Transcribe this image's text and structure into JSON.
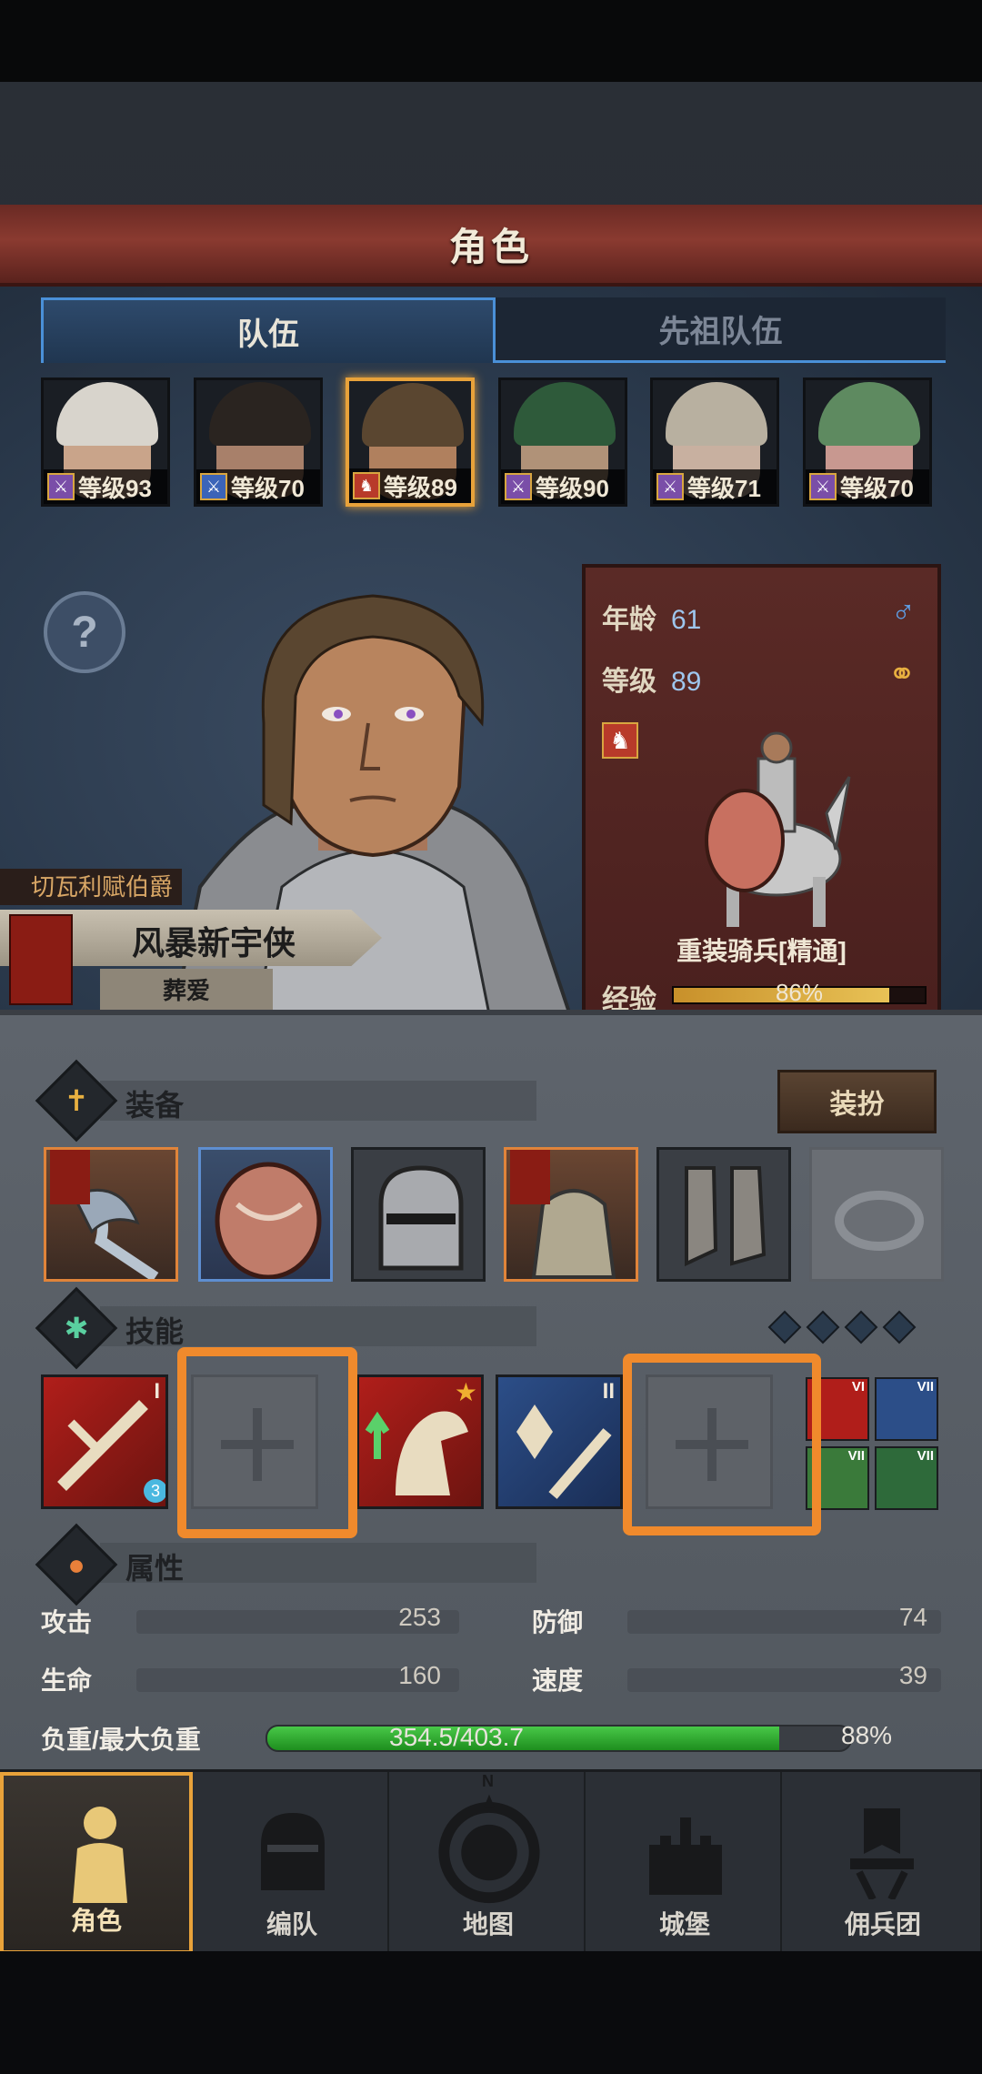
{
  "header": {
    "title": "角色"
  },
  "tabs": [
    {
      "label": "队伍",
      "active": true
    },
    {
      "label": "先祖队伍",
      "active": false
    }
  ],
  "party": [
    {
      "level": "等级93",
      "class_color": "#7a4ea8",
      "hair": "#d8d4cc",
      "skin": "#c9a48a",
      "selected": false
    },
    {
      "level": "等级70",
      "class_color": "#3b64b8",
      "hair": "#2a2420",
      "skin": "#a8806a",
      "selected": false
    },
    {
      "level": "等级89",
      "class_color": "#b83a2a",
      "hair": "#5a4630",
      "skin": "#b0805e",
      "selected": true
    },
    {
      "level": "等级90",
      "class_color": "#7a4ea8",
      "hair": "#2e5a3a",
      "skin": "#b09278",
      "selected": false
    },
    {
      "level": "等级71",
      "class_color": "#7a4ea8",
      "hair": "#b8b0a0",
      "skin": "#c8b0a0",
      "selected": false
    },
    {
      "level": "等级70",
      "class_color": "#7a4ea8",
      "hair": "#5e8a60",
      "skin": "#c89890",
      "selected": false
    }
  ],
  "hero": {
    "title_tag": "切瓦利赋伯爵",
    "name": "风暴新宇侠",
    "trait": "葬爱",
    "age_label": "年龄",
    "age": "61",
    "level_label": "等级",
    "level": "89",
    "gender_icon": "male-icon",
    "class_name": "重装骑兵[精通]",
    "exp_label": "经验",
    "exp_percent": 86,
    "exp_text": "86%"
  },
  "equipment": {
    "title": "装备",
    "dress_button": "装扮",
    "slots": [
      {
        "name": "weapon-slot",
        "style": "orange"
      },
      {
        "name": "shield-slot",
        "style": "blue"
      },
      {
        "name": "helmet-slot",
        "style": "normal"
      },
      {
        "name": "armor-slot",
        "style": "orange"
      },
      {
        "name": "boots-slot",
        "style": "normal"
      },
      {
        "name": "ring-slot",
        "style": "empty"
      }
    ]
  },
  "skills": {
    "title": "技能",
    "rank_1": "I",
    "rank_2": "II",
    "badge_count": "3",
    "mini": [
      "VI",
      "VII",
      "VII",
      "VII"
    ]
  },
  "attributes": {
    "title": "属性",
    "attack_label": "攻击",
    "attack": "253",
    "defense_label": "防御",
    "defense": "74",
    "hp_label": "生命",
    "hp": "160",
    "speed_label": "速度",
    "speed": "39",
    "load_label": "负重/最大负重",
    "load_text": "354.5/403.7",
    "load_percent": "88%",
    "load_fraction": 0.878
  },
  "nav": [
    {
      "label": "角色",
      "active": true
    },
    {
      "label": "编队",
      "active": false
    },
    {
      "label": "地图",
      "active": false
    },
    {
      "label": "城堡",
      "active": false
    },
    {
      "label": "佣兵团",
      "active": false
    }
  ],
  "compass_letter": "N"
}
